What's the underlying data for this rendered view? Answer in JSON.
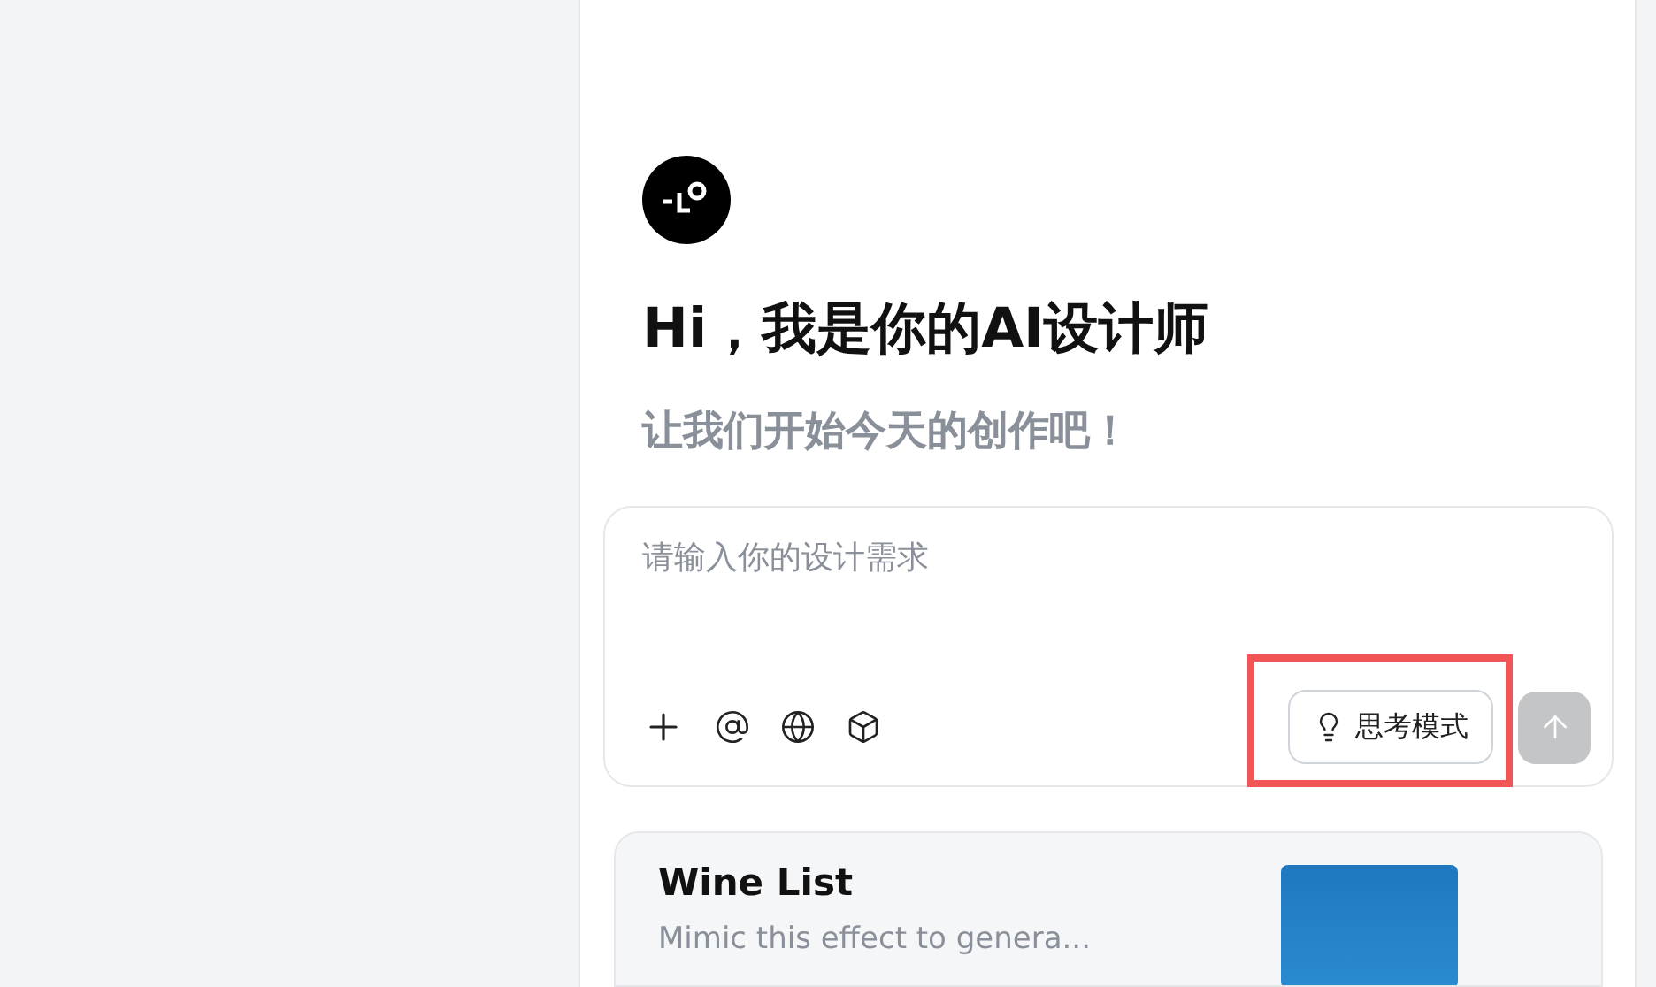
{
  "greeting": {
    "title": "Hi，我是你的AI设计师",
    "subtitle": "让我们开始今天的创作吧！"
  },
  "composer": {
    "placeholder": "请输入你的设计需求",
    "tools": [
      {
        "kind": "plus"
      },
      {
        "kind": "mention"
      },
      {
        "kind": "globe"
      },
      {
        "kind": "cube"
      }
    ],
    "think_mode": {
      "label": "思考模式",
      "highlighted": true
    },
    "send": {
      "disabled": true
    }
  },
  "templates": [
    {
      "title": "Wine List",
      "description": "Mimic this effect to genera..."
    }
  ]
}
